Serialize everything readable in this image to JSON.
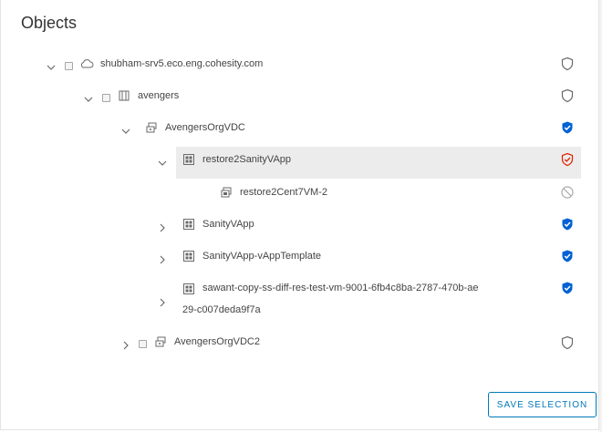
{
  "panel": {
    "title": "Objects"
  },
  "tree": [
    {
      "label": "shubham-srv5.eco.eng.cohesity.com",
      "expand": "expanded",
      "has_checkbox": true,
      "icon": "cloud-icon",
      "protection": "unprotected-shield"
    },
    {
      "label": "avengers",
      "expand": "expanded",
      "has_checkbox": true,
      "icon": "organization-icon",
      "protection": "unprotected-shield"
    },
    {
      "label": "AvengersOrgVDC",
      "expand": "expanded",
      "has_checkbox": false,
      "icon": "vdc-icon",
      "protection": "protected-shield"
    },
    {
      "label": "restore2SanityVApp",
      "expand": "expanded",
      "has_checkbox": false,
      "icon": "vapp-icon",
      "protection": "error-shield",
      "selected": true
    },
    {
      "label": "restore2Cent7VM-2",
      "expand": "none",
      "has_checkbox": false,
      "icon": "vm-icon",
      "protection": "excluded-icon"
    },
    {
      "label": "SanityVApp",
      "expand": "collapsed",
      "has_checkbox": false,
      "icon": "vapp-icon",
      "protection": "protected-shield"
    },
    {
      "label": "SanityVApp-vAppTemplate",
      "expand": "collapsed",
      "has_checkbox": false,
      "icon": "vapp-icon",
      "protection": "protected-shield"
    },
    {
      "label": "sawant-copy-ss-diff-res-test-vm-9001-6fb4c8ba-2787-470b-ae29-c007deda9f7a",
      "expand": "collapsed",
      "has_checkbox": false,
      "icon": "vapp-icon",
      "protection": "protected-shield"
    },
    {
      "label": "AvengersOrgVDC2",
      "expand": "collapsed",
      "has_checkbox": true,
      "icon": "vdc-icon",
      "protection": "unprotected-shield"
    }
  ],
  "footer": {
    "save_label": "SAVE SELECTION"
  },
  "colors": {
    "accent": "#0079b8",
    "protected": "#0061d5",
    "error": "#e12200",
    "neutral_icon": "#6a6a6a"
  }
}
